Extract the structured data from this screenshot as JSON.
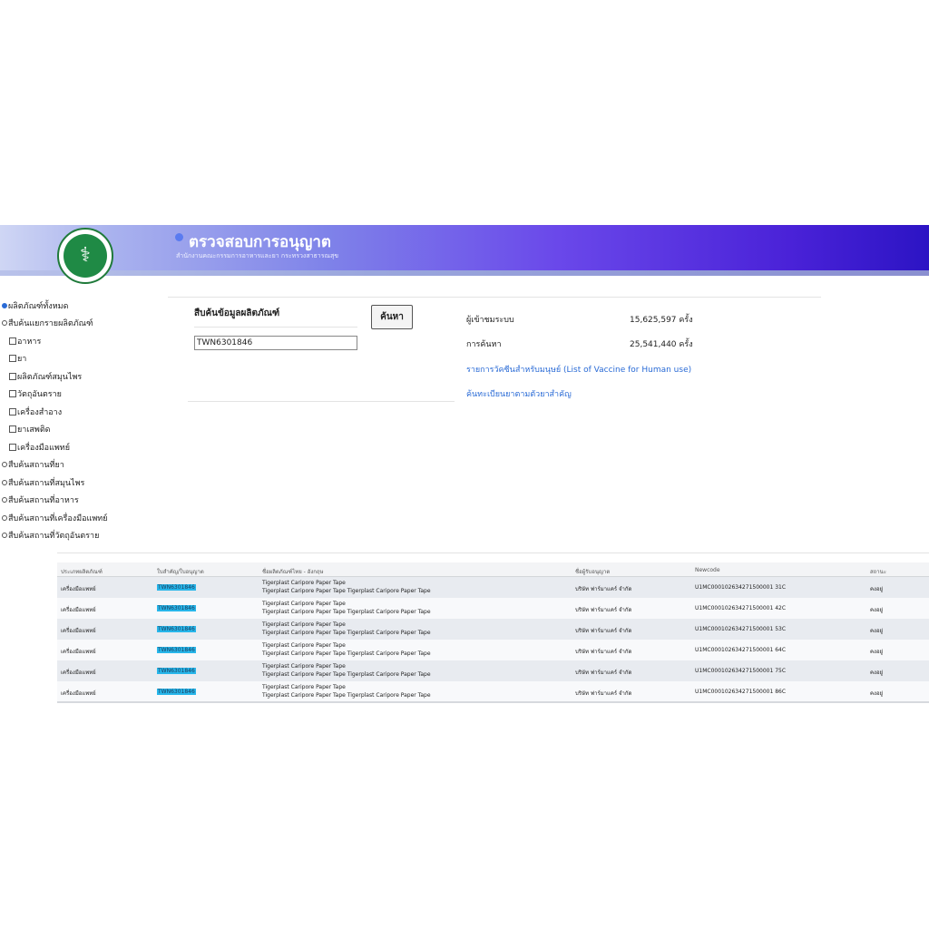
{
  "header": {
    "title": "ตรวจสอบการอนุญาต",
    "subtitle": "สำนักงานคณะกรรมการอาหารและยา กระทรวงสาธารณสุข",
    "logo_icon": "moph-logo-icon"
  },
  "filters": {
    "items": [
      {
        "label": "ผลิตภัณฑ์ทั้งหมด",
        "type": "radio",
        "checked": true
      },
      {
        "label": "สืบค้นแยกรายผลิตภัณฑ์",
        "type": "radio",
        "checked": false
      },
      {
        "label": "อาหาร",
        "type": "checkbox",
        "checked": false
      },
      {
        "label": "ยา",
        "type": "checkbox",
        "checked": false
      },
      {
        "label": "ผลิตภัณฑ์สมุนไพร",
        "type": "checkbox",
        "checked": false
      },
      {
        "label": "วัตถุอันตราย",
        "type": "checkbox",
        "checked": false
      },
      {
        "label": "เครื่องสำอาง",
        "type": "checkbox",
        "checked": false
      },
      {
        "label": "ยาเสพติด",
        "type": "checkbox",
        "checked": false
      },
      {
        "label": "เครื่องมือแพทย์",
        "type": "checkbox",
        "checked": false
      },
      {
        "label": "สืบค้นสถานที่ยา",
        "type": "radio",
        "checked": false
      },
      {
        "label": "สืบค้นสถานที่สมุนไพร",
        "type": "radio",
        "checked": false
      },
      {
        "label": "สืบค้นสถานที่อาหาร",
        "type": "radio",
        "checked": false
      },
      {
        "label": "สืบค้นสถานที่เครื่องมือแพทย์",
        "type": "radio",
        "checked": false
      },
      {
        "label": "สืบค้นสถานที่วัตถุอันตราย",
        "type": "radio",
        "checked": false
      }
    ]
  },
  "search": {
    "label": "สืบค้นข้อมูลผลิตภัณฑ์",
    "value": "TWN6301846",
    "button": "ค้นหา"
  },
  "stats": {
    "visitors_label": "ผู้เข้าชมระบบ",
    "visitors_value": "15,625,597 ครั้ง",
    "searches_label": "การค้นหา",
    "searches_value": "25,541,440 ครั้ง",
    "link_vaccine": "รายการวัคซีนสำหรับมนุษย์ (List of Vaccine for Human use)",
    "link_drug": "ค้นทะเบียนยาตามตัวยาสำคัญ"
  },
  "table": {
    "headers": [
      "ประเภทผลิตภัณฑ์",
      "ใบสำคัญ/ใบอนุญาต",
      "ชื่อผลิตภัณฑ์ไทย - อังกฤษ",
      "ชื่อผู้รับอนุญาต",
      "Newcode",
      "สถานะ"
    ],
    "rows": [
      {
        "type": "เครื่องมือแพทย์",
        "license": "TWN6301846",
        "name1": "Tigerplast Caripore Paper Tape",
        "name2": "Tigerplast Caripore Paper Tape Tigerplast Caripore Paper Tape",
        "licensee": "บริษัท ฟาร์มาแคร์ จำกัด",
        "newcode": "U1MC000102634271500001 31C",
        "status": "คงอยู่"
      },
      {
        "type": "เครื่องมือแพทย์",
        "license": "TWN6301846",
        "name1": "Tigerplast Caripore Paper Tape",
        "name2": "Tigerplast Caripore Paper Tape Tigerplast Caripore Paper Tape",
        "licensee": "บริษัท ฟาร์มาแคร์ จำกัด",
        "newcode": "U1MC000102634271500001 42C",
        "status": "คงอยู่"
      },
      {
        "type": "เครื่องมือแพทย์",
        "license": "TWN6301846",
        "name1": "Tigerplast Caripore Paper Tape",
        "name2": "Tigerplast Caripore Paper Tape Tigerplast Caripore Paper Tape",
        "licensee": "บริษัท ฟาร์มาแคร์ จำกัด",
        "newcode": "U1MC000102634271500001 53C",
        "status": "คงอยู่"
      },
      {
        "type": "เครื่องมือแพทย์",
        "license": "TWN6301846",
        "name1": "Tigerplast Caripore Paper Tape",
        "name2": "Tigerplast Caripore Paper Tape Tigerplast Caripore Paper Tape",
        "licensee": "บริษัท ฟาร์มาแคร์ จำกัด",
        "newcode": "U1MC000102634271500001 64C",
        "status": "คงอยู่"
      },
      {
        "type": "เครื่องมือแพทย์",
        "license": "TWN6301846",
        "name1": "Tigerplast Caripore Paper Tape",
        "name2": "Tigerplast Caripore Paper Tape Tigerplast Caripore Paper Tape",
        "licensee": "บริษัท ฟาร์มาแคร์ จำกัด",
        "newcode": "U1MC000102634271500001 75C",
        "status": "คงอยู่"
      },
      {
        "type": "เครื่องมือแพทย์",
        "license": "TWN6301846",
        "name1": "Tigerplast Caripore Paper Tape",
        "name2": "Tigerplast Caripore Paper Tape Tigerplast Caripore Paper Tape",
        "licensee": "บริษัท ฟาร์มาแคร์ จำกัด",
        "newcode": "U1MC000102634271500001 86C",
        "status": "คงอยู่"
      }
    ]
  },
  "colors": {
    "link": "#2a6bd6",
    "highlight": "#27b6ea",
    "banner_end": "#2c14c4"
  }
}
